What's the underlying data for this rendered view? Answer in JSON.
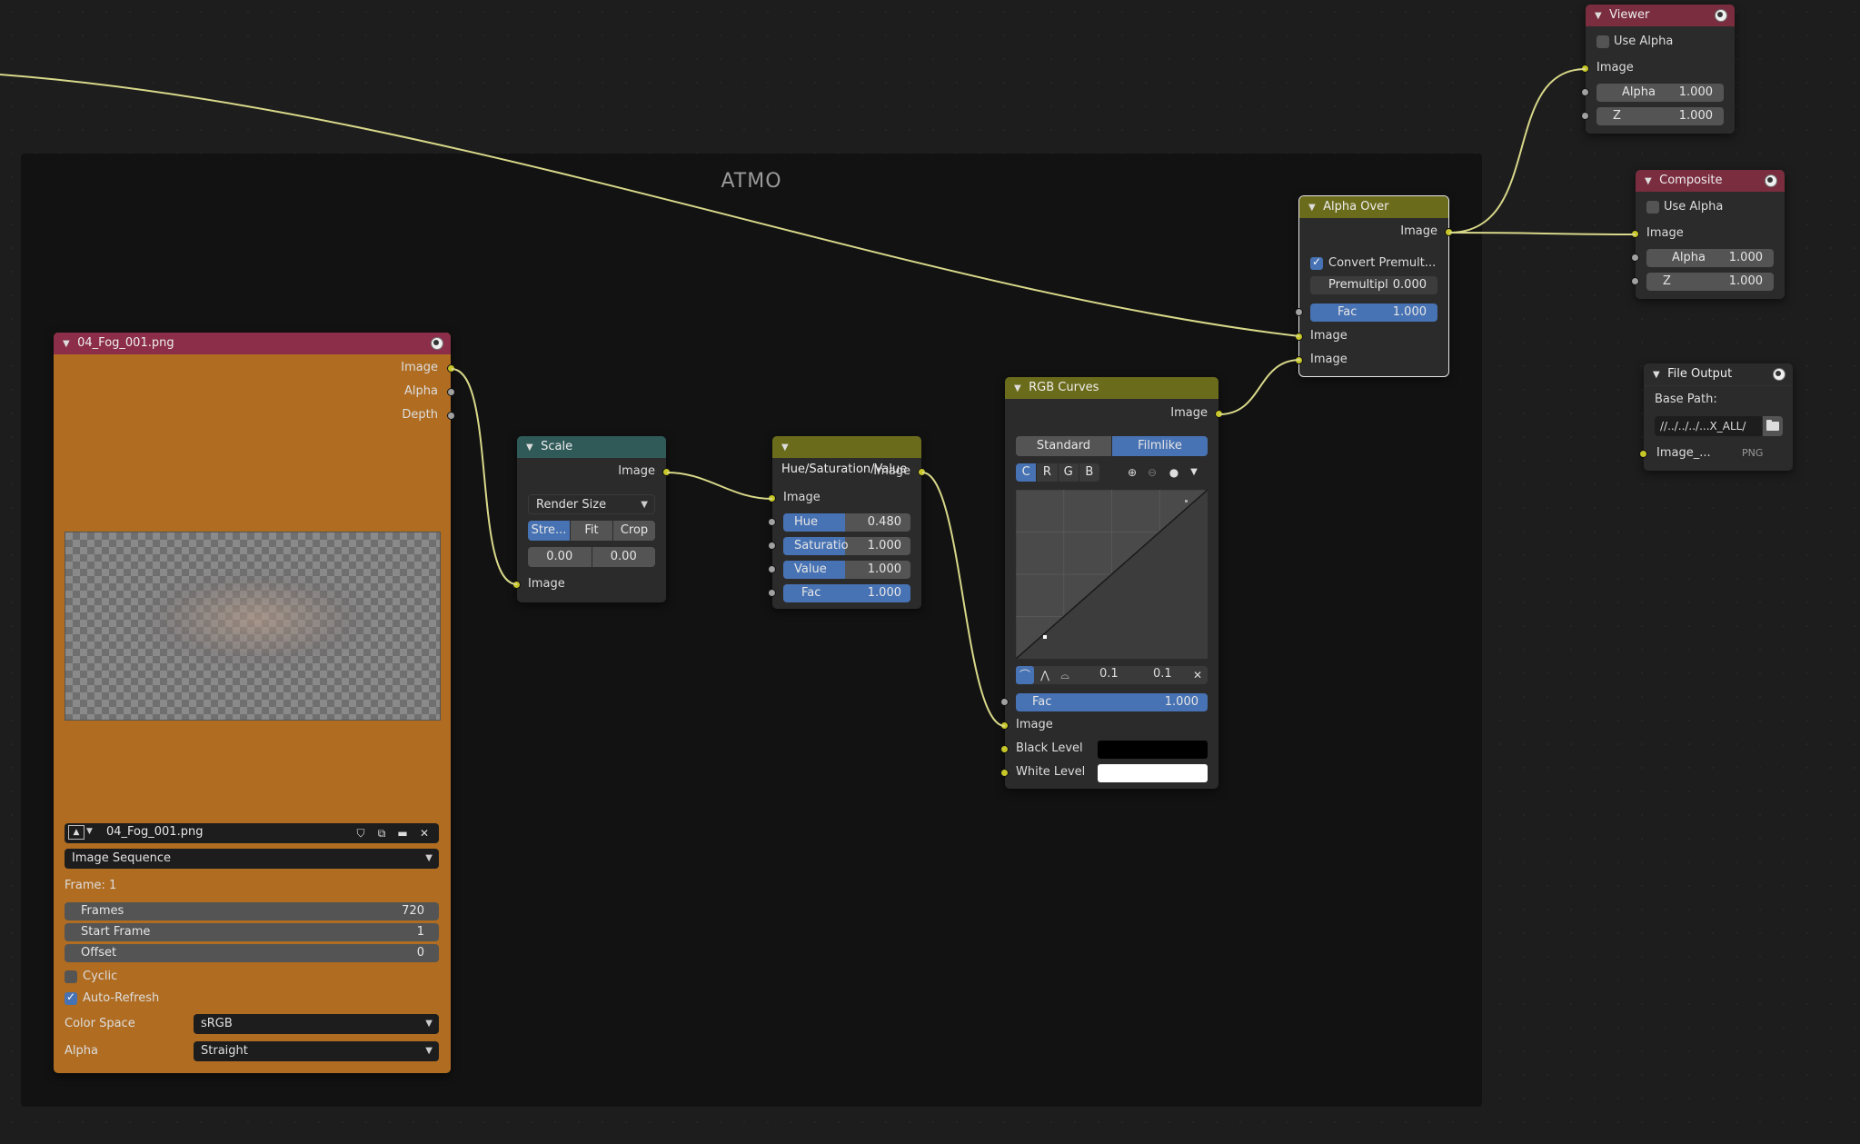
{
  "frame": {
    "label": "ATMO"
  },
  "image_node": {
    "title": "04_Fog_001.png",
    "outputs": [
      "Image",
      "Alpha",
      "Depth"
    ],
    "image_name": "04_Fog_001.png",
    "source": "Image Sequence",
    "frame_info": "Frame: 1",
    "frames_label": "Frames",
    "frames_value": "720",
    "start_label": "Start Frame",
    "start_value": "1",
    "offset_label": "Offset",
    "offset_value": "0",
    "cyclic_label": "Cyclic",
    "autorefresh_label": "Auto-Refresh",
    "colorspace_label": "Color Space",
    "colorspace_value": "sRGB",
    "alpha_label": "Alpha",
    "alpha_value": "Straight",
    "color": "#b06d22"
  },
  "scale_node": {
    "title": "Scale",
    "output": "Image",
    "space": "Render Size",
    "modes": [
      "Stre...",
      "Fit",
      "Crop"
    ],
    "offset_x": "0.00",
    "offset_y": "0.00",
    "input": "Image"
  },
  "hsv_node": {
    "title": "Hue/Saturation/Value",
    "output": "Image",
    "input": "Image",
    "hue_label": "Hue",
    "hue_value": "0.480",
    "sat_label": "Saturatio",
    "sat_value": "1.000",
    "val_label": "Value",
    "val_value": "1.000",
    "fac_label": "Fac",
    "fac_value": "1.000"
  },
  "curves_node": {
    "title": "RGB Curves",
    "output": "Image",
    "tabs": [
      "Standard",
      "Filmlike"
    ],
    "channels": [
      "C",
      "R",
      "G",
      "B"
    ],
    "clip_min": "0.1",
    "clip_max": "0.1",
    "fac_label": "Fac",
    "fac_value": "1.000",
    "input_image": "Image",
    "black_label": "Black Level",
    "white_label": "White Level"
  },
  "alpha_over_node": {
    "title": "Alpha Over",
    "output": "Image",
    "convert_label": "Convert Premult...",
    "premul_label": "Premultipl",
    "premul_value": "0.000",
    "fac_label": "Fac",
    "fac_value": "1.000",
    "input1": "Image",
    "input2": "Image"
  },
  "viewer_node": {
    "title": "Viewer",
    "use_alpha_label": "Use Alpha",
    "input": "Image",
    "alpha_label": "Alpha",
    "alpha_value": "1.000",
    "z_label": "Z",
    "z_value": "1.000"
  },
  "composite_node": {
    "title": "Composite",
    "use_alpha_label": "Use Alpha",
    "input": "Image",
    "alpha_label": "Alpha",
    "alpha_value": "1.000",
    "z_label": "Z",
    "z_value": "1.000"
  },
  "file_output_node": {
    "title": "File Output",
    "base_path_label": "Base Path:",
    "base_path_value": "//../../../...X_ALL/",
    "input_label": "Image_...",
    "format": "PNG"
  },
  "colors": {
    "background": "#1d1d1d",
    "frame": "#121212",
    "node_body": "#2b2b2b",
    "output_header": "#7a2d3f",
    "color_header": "#6b6b1c",
    "distort_header": "#2f5a58",
    "accent": "#4772b3",
    "wire": "#c7c729"
  }
}
